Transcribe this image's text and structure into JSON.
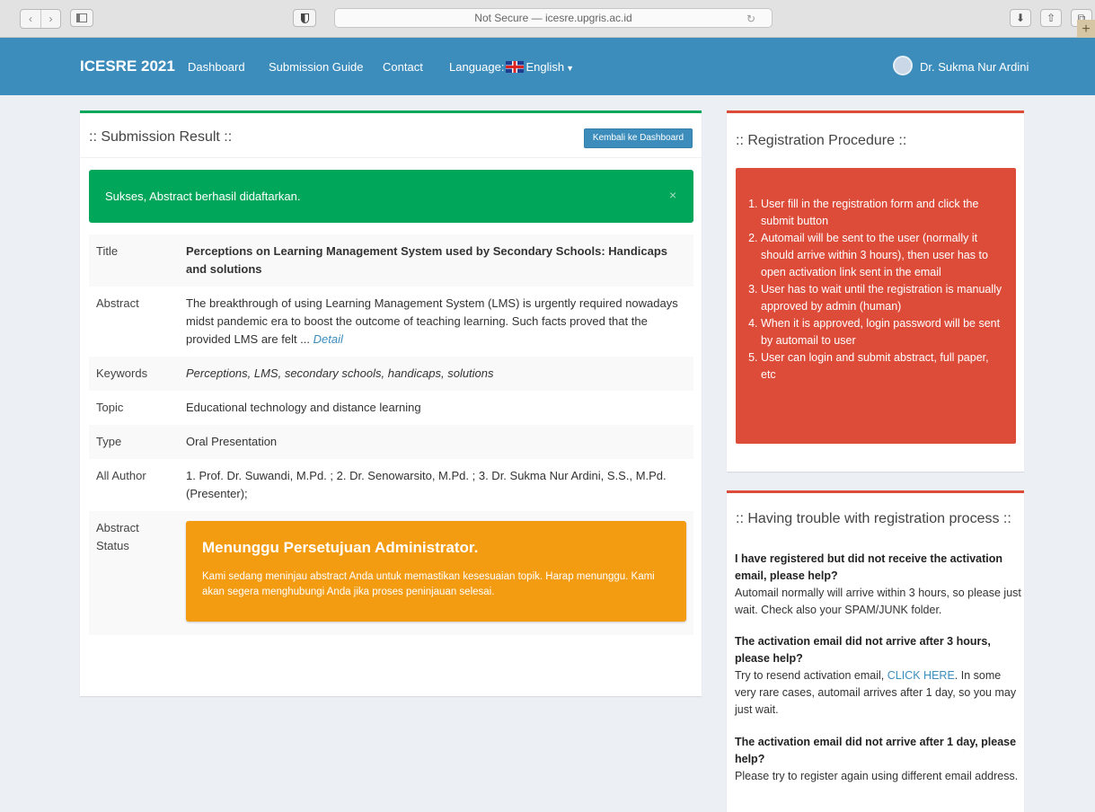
{
  "browser": {
    "url_text": "Not Secure — icesre.upgris.ac.id",
    "back_glyph": "‹",
    "forward_glyph": "›",
    "reload_glyph": "↻",
    "download_glyph": "⬇",
    "share_glyph": "⇧",
    "tabs_glyph": "⧉",
    "plus_glyph": "+"
  },
  "navbar": {
    "brand": "ICESRE 2021",
    "links": [
      "Dashboard",
      "Submission Guide",
      "Contact"
    ],
    "language_label": "Language:",
    "language_value": "English",
    "user_name": "Dr. Sukma Nur Ardini",
    "color": "#3c8dbc"
  },
  "main": {
    "title": ":: Submission Result ::",
    "back_button": "Kembali ke Dashboard",
    "alert": "Sukses, Abstract berhasil didaftarkan.",
    "alert_close": "×",
    "rows": {
      "title_label": "Title",
      "title_value": "Perceptions on Learning Management System used by Secondary Schools: Handicaps and solutions",
      "abstract_label": "Abstract",
      "abstract_value": "The breakthrough of using Learning Management System (LMS) is urgently required nowadays midst pandemic era to boost the outcome of teaching learning. Such facts proved that the provided LMS are felt ...",
      "abstract_link": "Detail",
      "keywords_label": "Keywords",
      "keywords_value": "Perceptions, LMS, secondary schools, handicaps, solutions",
      "topic_label": "Topic",
      "topic_value": "Educational technology and distance learning",
      "type_label": "Type",
      "type_value": "Oral Presentation",
      "authors_label": "All Author",
      "authors_value": "1. Prof. Dr. Suwandi, M.Pd. ; 2. Dr. Senowarsito, M.Pd. ; 3. Dr. Sukma Nur Ardini, S.S., M.Pd. (Presenter);",
      "status_label": "Abstract Status"
    },
    "status": {
      "title": "Menunggu Persetujuan Administrator.",
      "text": "Kami sedang meninjau abstract Anda untuk memastikan kesesuaian topik. Harap menunggu. Kami akan segera menghubungi Anda jika proses peninjauan selesai.",
      "color": "#f39c12"
    },
    "success_color": "#00a65a"
  },
  "registration": {
    "title": ":: Registration Procedure ::",
    "steps": [
      "User fill in the registration form and click the submit button",
      "Automail will be sent to the user (normally it should arrive within 3 hours), then user has to open activation link sent in the email",
      "User has to wait until the registration is manually approved by admin (human)",
      "When it is approved, login password will be sent by automail to user",
      "User can login and submit abstract, full paper, etc"
    ],
    "color": "#dd4b39"
  },
  "trouble": {
    "title": ":: Having trouble with registration process ::",
    "q1": "I have registered but did not receive the activation email, please help?",
    "a1": "Automail normally will arrive within 3 hours, so please just wait. Check also your SPAM/JUNK folder.",
    "q2": "The activation email did not arrive after 3 hours, please help?",
    "a2_pre": "Try to resend activation email,",
    "a2_link": "CLICK HERE",
    "a2_post": ". In some very rare cases, automail arrives after 1 day, so you may just wait.",
    "q3": "The activation email did not arrive after 1 day, please help?",
    "a3": "Please try to register again using different email address."
  }
}
